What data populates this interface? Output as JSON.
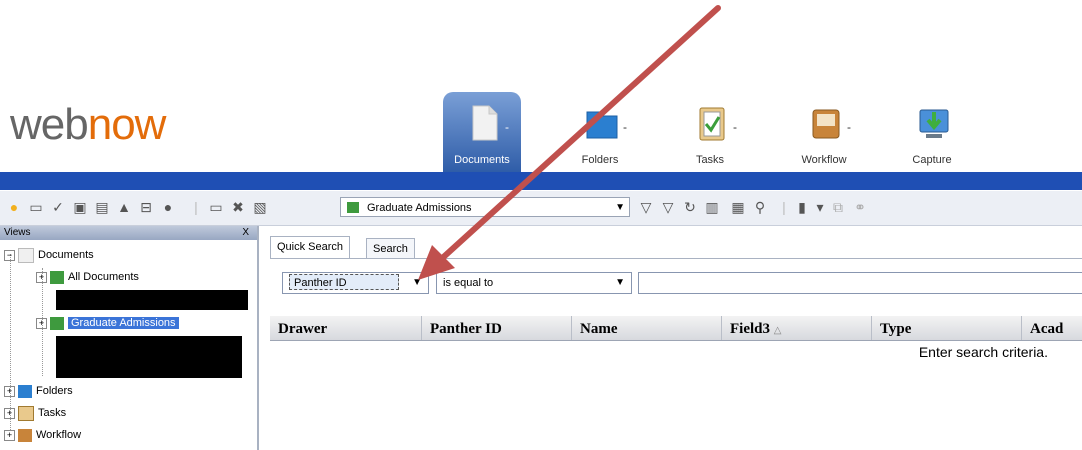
{
  "caption_partial": "",
  "logo": {
    "part1": "web",
    "part2": "now"
  },
  "nav": [
    {
      "label": "Documents",
      "icon": "documents-icon",
      "active": true
    },
    {
      "label": "Folders",
      "icon": "folders-icon"
    },
    {
      "label": "Tasks",
      "icon": "tasks-icon"
    },
    {
      "label": "Workflow",
      "icon": "workflow-icon"
    },
    {
      "label": "Capture",
      "icon": "capture-icon"
    }
  ],
  "toolbar": {
    "drawer_select_value": "Graduate Admissions"
  },
  "views": {
    "title": "Views",
    "close": "X",
    "items": {
      "documents": "Documents",
      "all_documents": "All Documents",
      "graduate_admissions": "Graduate Admissions",
      "folders": "Folders",
      "tasks": "Tasks",
      "workflow": "Workflow"
    }
  },
  "search": {
    "tabs": [
      "Quick Search",
      "Search"
    ],
    "field_value": "Panther ID",
    "operator_value": "is equal to",
    "query_value": "",
    "columns": [
      "Drawer",
      "Panther ID",
      "Name",
      "Field3",
      "Type",
      "Acad"
    ],
    "empty_message": "Enter search criteria."
  },
  "colors": {
    "accent": "#1f4fb4",
    "arrow": "#c0504d",
    "logo_orange": "#e36c0a",
    "logo_gray": "#666666"
  }
}
